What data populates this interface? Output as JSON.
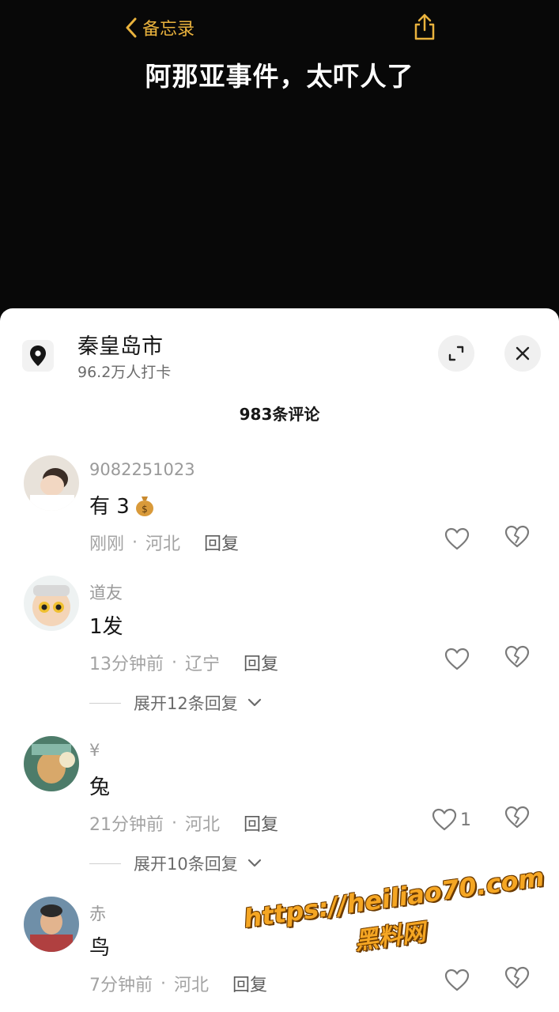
{
  "header": {
    "back_label": "备忘录",
    "video_title": "阿那亚事件，太吓人了"
  },
  "location": {
    "name": "秦皇岛市",
    "checkins": "96.2万人打卡"
  },
  "comments_count_label": "983条评论",
  "comments": [
    {
      "user": "9082251023",
      "text": "有 3",
      "emoji": "money-bag",
      "time": "刚刚",
      "region": "河北",
      "reply_label": "回复",
      "likes": ""
    },
    {
      "user": "道友",
      "text": "1发",
      "time": "13分钟前",
      "region": "辽宁",
      "reply_label": "回复",
      "likes": "",
      "expand_label": "展开12条回复"
    },
    {
      "user": "¥",
      "text": "兔",
      "time": "21分钟前",
      "region": "河北",
      "reply_label": "回复",
      "likes": "1",
      "expand_label": "展开10条回复"
    },
    {
      "user": "赤",
      "text": "鸟",
      "time": "7分钟前",
      "region": "河北",
      "reply_label": "回复",
      "likes": ""
    }
  ],
  "watermark": {
    "line1": "https://heiliao70.com",
    "line2": "黑料网"
  },
  "colors": {
    "accent": "#e9b23d",
    "watermark": "#f5a623"
  }
}
